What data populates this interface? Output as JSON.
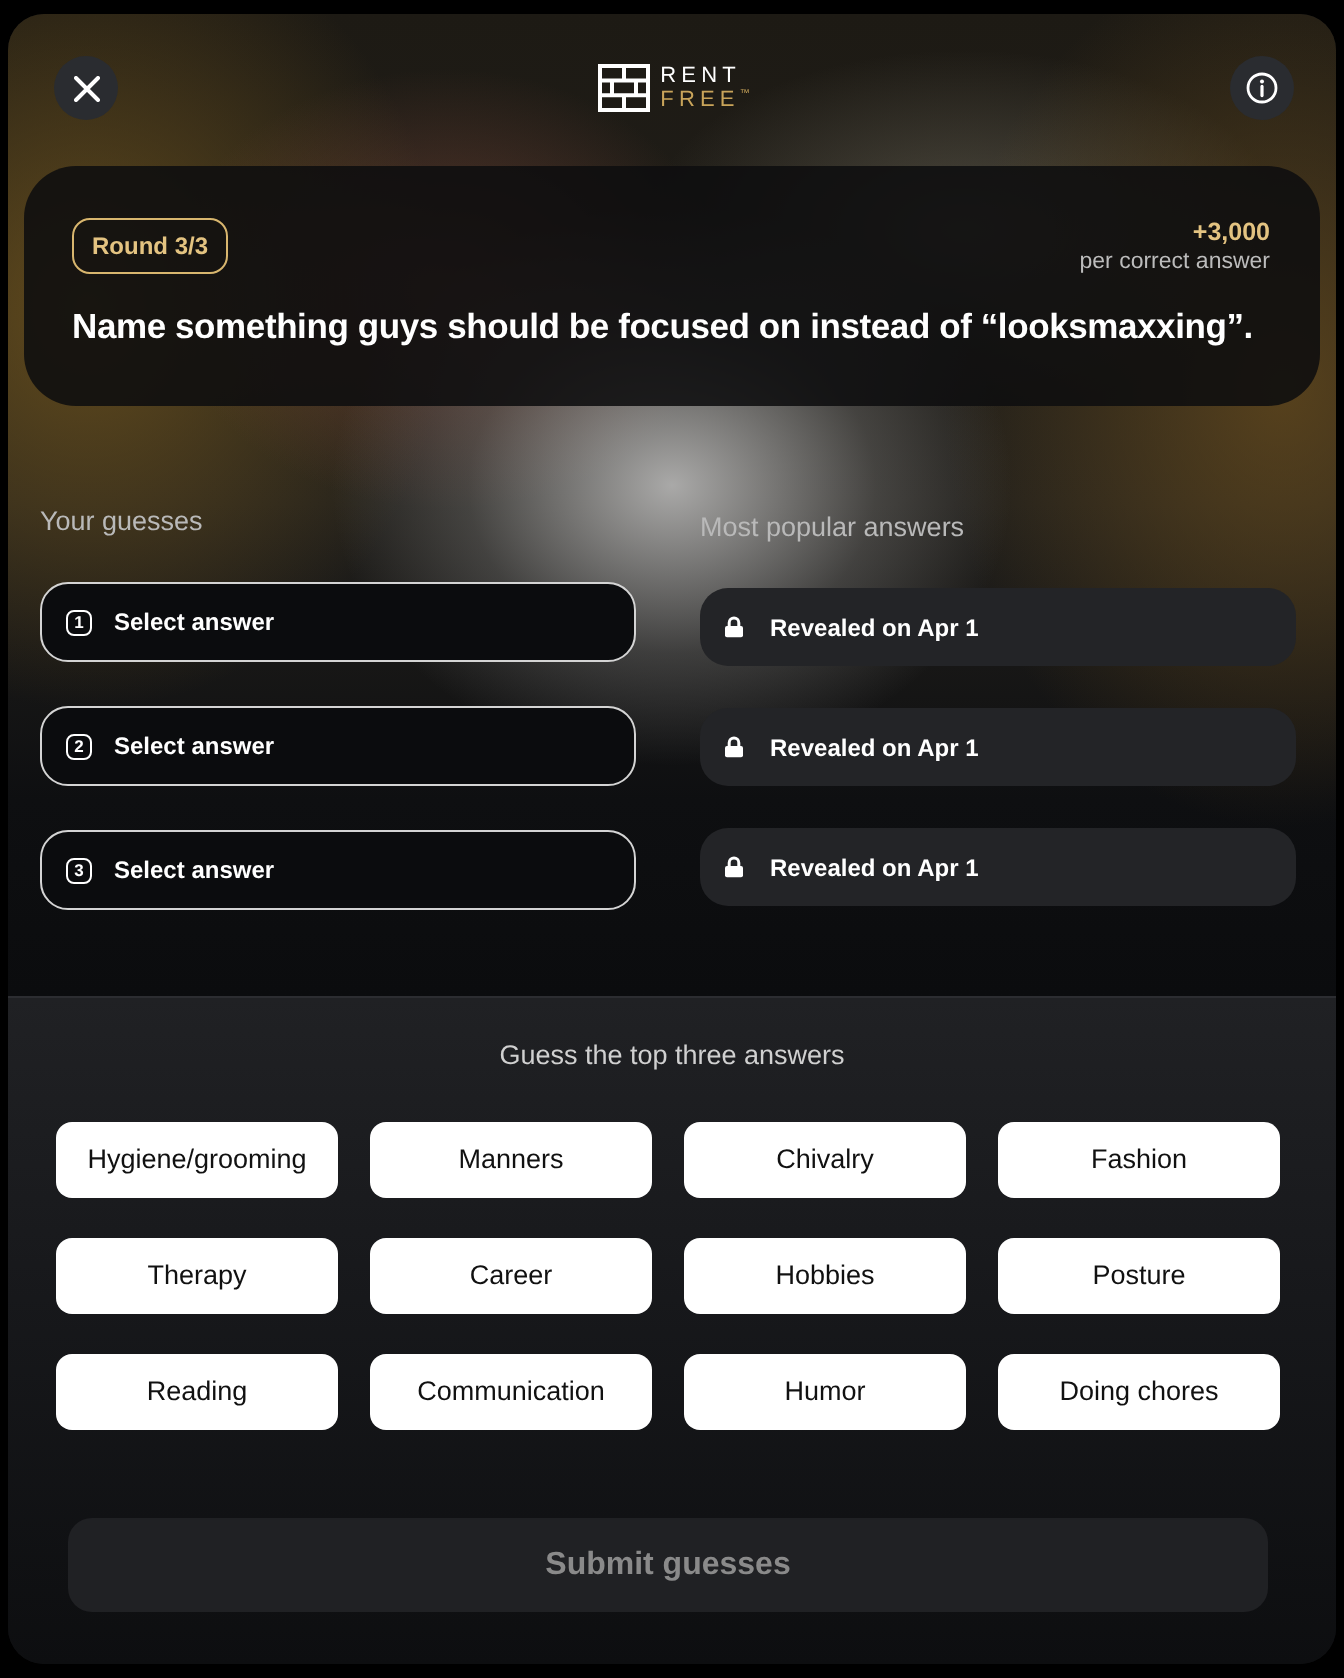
{
  "logo": {
    "line_1": "RENT",
    "line_2": "FREE$^{™}$"
  },
  "question_card": {
    "round_badge": "Round 3/3",
    "points": "+3,000",
    "points_caption": "per correct answer",
    "question": "Name something guys should be focused on instead of “looksmaxxing”."
  },
  "guesses": {
    "heading": "Your guesses",
    "slots": [
      {
        "number": "1",
        "label": "Select answer"
      },
      {
        "number": "2",
        "label": "Select answer"
      },
      {
        "number": "3",
        "label": "Select answer"
      }
    ]
  },
  "popular": {
    "heading": "Most popular answers",
    "answers": [
      {
        "label": "Revealed on Apr 1",
        "locked": true
      },
      {
        "label": "Revealed on Apr 1",
        "locked": true
      },
      {
        "label": "Revealed on Apr 1",
        "locked": true
      }
    ]
  },
  "answer_options": {
    "heading": "Guess the top three answers",
    "options": [
      {
        "label": "Hygiene/grooming",
        "selected": false
      },
      {
        "label": "Manners",
        "selected": false
      },
      {
        "label": "Chivalry",
        "selected": false
      },
      {
        "label": "Fashion",
        "selected": false
      },
      {
        "label": "Therapy",
        "selected": false
      },
      {
        "label": "Career",
        "selected": false
      },
      {
        "label": "Hobbies",
        "selected": false
      },
      {
        "label": "Posture",
        "selected": false
      },
      {
        "label": "Reading",
        "selected": false
      },
      {
        "label": "Communication",
        "selected": false
      },
      {
        "label": "Humor",
        "selected": false
      },
      {
        "label": "Doing chores",
        "selected": false
      }
    ]
  },
  "submit_button": {
    "label": "Submit guesses",
    "disabled": true
  }
}
